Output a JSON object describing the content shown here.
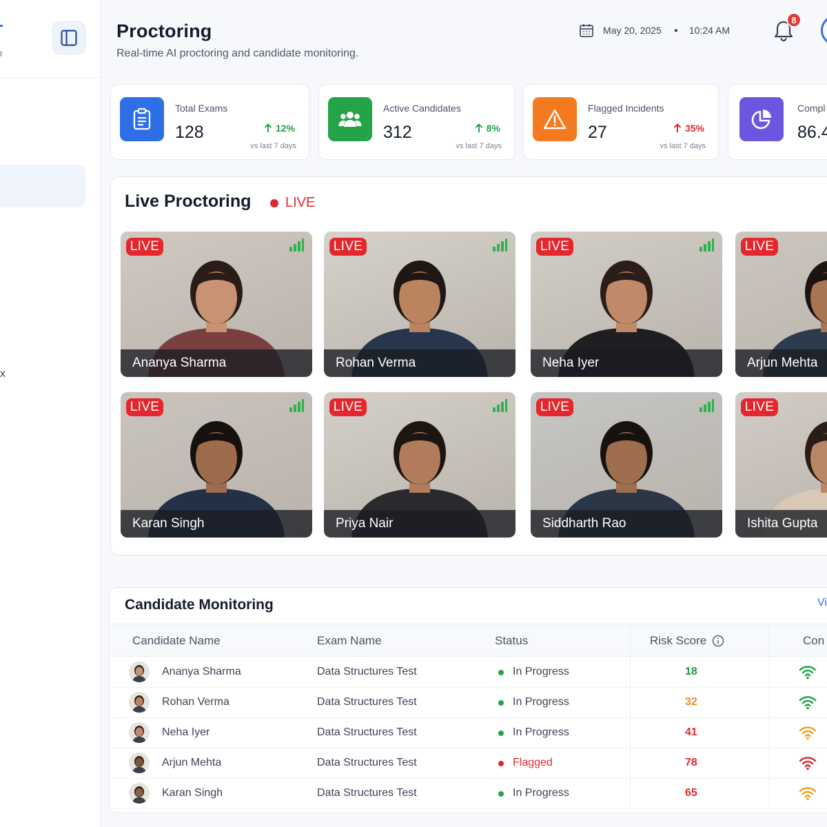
{
  "header": {
    "title": "Proctoring",
    "subtitle": "Real-time AI proctoring and candidate monitoring.",
    "date": "May 20, 2025",
    "time": "10:24 AM",
    "notification_count": "8"
  },
  "sidebar": {
    "fragment_label": "x"
  },
  "stats": [
    {
      "label": "Total Exams",
      "value": "128",
      "trend": "12%",
      "trend_dir": "up",
      "note": "vs last 7 days",
      "color": "#2f6fe6",
      "icon": "clipboard-icon",
      "trend_color": "#23a24d"
    },
    {
      "label": "Active Candidates",
      "value": "312",
      "trend": "8%",
      "trend_dir": "up",
      "note": "vs last 7 days",
      "color": "#22a447",
      "icon": "users-icon",
      "trend_color": "#23a24d"
    },
    {
      "label": "Flagged Incidents",
      "value": "27",
      "trend": "35%",
      "trend_dir": "up",
      "note": "vs last 7 days",
      "color": "#f47a1f",
      "icon": "warning-icon",
      "trend_color": "#e0282c"
    },
    {
      "label": "Compl",
      "value": "86.4",
      "color": "#6b56e0",
      "icon": "pie-chart-icon"
    }
  ],
  "live": {
    "title": "Live Proctoring",
    "badge": "LIVE",
    "tile_tag": "LIVE",
    "tiles": [
      {
        "name": "Ananya Sharma"
      },
      {
        "name": "Rohan Verma"
      },
      {
        "name": "Neha Iyer"
      },
      {
        "name": "Arjun Mehta"
      },
      {
        "name": "Karan Singh"
      },
      {
        "name": "Priya Nair"
      },
      {
        "name": "Siddharth Rao"
      },
      {
        "name": "Ishita Gupta"
      }
    ]
  },
  "monitoring": {
    "title": "Candidate Monitoring",
    "view_all": "Vi",
    "columns": [
      "Candidate Name",
      "Exam Name",
      "Status",
      "Risk Score",
      "Con"
    ],
    "rows": [
      {
        "name": "Ananya Sharma",
        "exam": "Data Structures Test",
        "status": "In Progress",
        "risk": "18",
        "risk_color": "#1f9a45",
        "status_color": "#22a447",
        "conn_color": "#22a447"
      },
      {
        "name": "Rohan Verma",
        "exam": "Data Structures Test",
        "status": "In Progress",
        "risk": "32",
        "risk_color": "#f08a24",
        "status_color": "#22a447",
        "conn_color": "#22a447"
      },
      {
        "name": "Neha Iyer",
        "exam": "Data Structures Test",
        "status": "In Progress",
        "risk": "41",
        "risk_color": "#e0282c",
        "status_color": "#22a447",
        "conn_color": "#f2a11b"
      },
      {
        "name": "Arjun Mehta",
        "exam": "Data Structures Test",
        "status": "Flagged",
        "risk": "78",
        "risk_color": "#e0282c",
        "status_color": "#e0282c",
        "conn_color": "#e0282c"
      },
      {
        "name": "Karan Singh",
        "exam": "Data Structures Test",
        "status": "In Progress",
        "risk": "65",
        "risk_color": "#e0282c",
        "status_color": "#22a447",
        "conn_color": "#f2a11b"
      }
    ]
  }
}
